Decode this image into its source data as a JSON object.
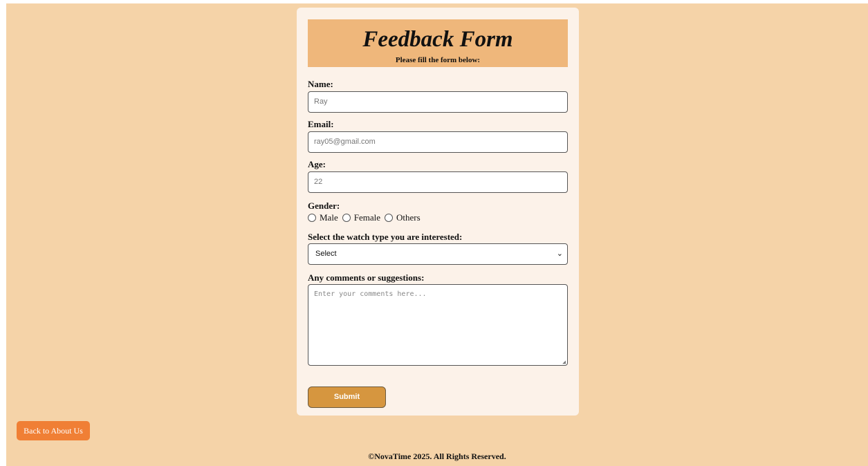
{
  "form": {
    "title": "Feedback Form",
    "subtitle": "Please fill the form below:",
    "name": {
      "label": "Name:",
      "value": "Ray"
    },
    "email": {
      "label": "Email:",
      "value": "ray05@gmail.com"
    },
    "age": {
      "label": "Age:",
      "value": "22"
    },
    "gender": {
      "label": "Gender:",
      "options": [
        "Male",
        "Female",
        "Others"
      ]
    },
    "watch": {
      "label": "Select the watch type you are interested:",
      "selected": "Select"
    },
    "comments": {
      "label": "Any comments or suggestions:",
      "placeholder": "Enter your comments here..."
    },
    "submit_label": "Submit"
  },
  "nav": {
    "back_label": "Back to About Us"
  },
  "footer": {
    "text": "©NovaTime 2025. All Rights Reserved."
  },
  "colors": {
    "page_bg": "#f5d3a8",
    "card_bg": "#fcf2e9",
    "header_bg": "#efb77b",
    "submit_bg": "#d6963f",
    "back_bg": "#f07f35"
  }
}
